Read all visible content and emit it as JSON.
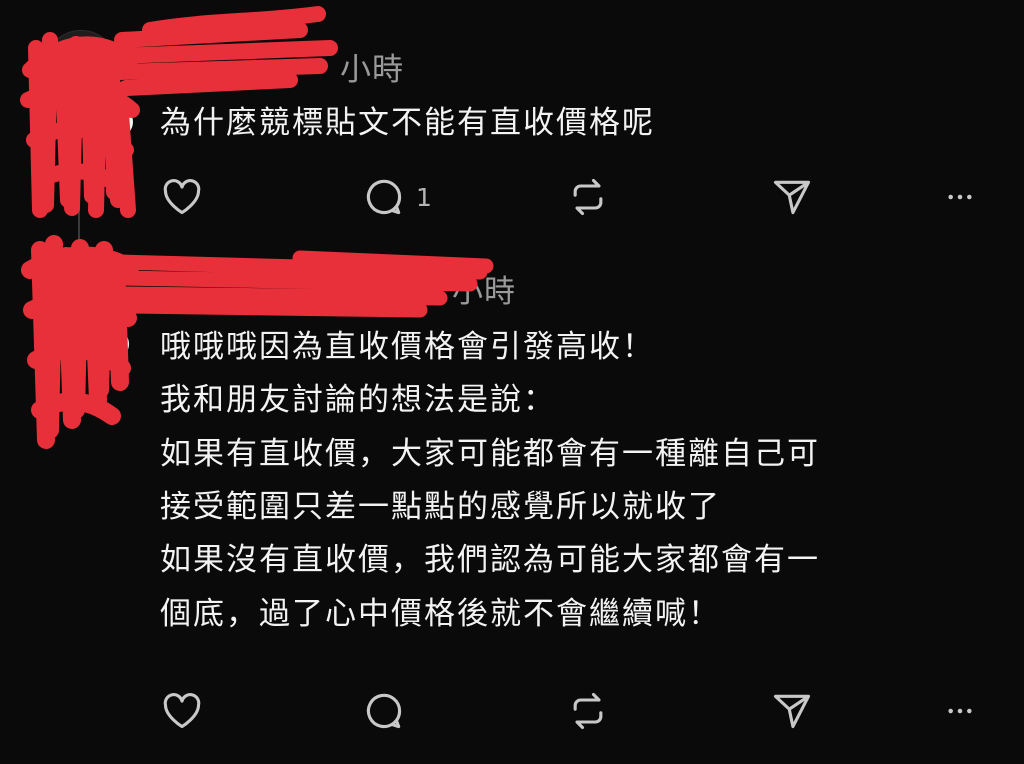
{
  "posts": [
    {
      "timestamp": "小時",
      "text": "為什麼競標貼文不能有直收價格呢",
      "actions": {
        "reply_count": "1"
      }
    },
    {
      "timestamp": "小時",
      "text": "哦哦哦因為直收價格會引發高收！\n我和朋友討論的想法是說：\n如果有直收價，大家可能都會有一種離自己可\n接受範圍只差一點點的感覺所以就收了\n如果沒有直收價，我們認為可能大家都會有一\n個底，過了心中價格後就不會繼續喊！",
      "actions": {
        "reply_count": ""
      }
    }
  ],
  "icons": {
    "like": "heart-icon",
    "reply": "comment-icon",
    "repost": "repost-icon",
    "share": "send-icon",
    "more": "more-icon"
  },
  "colors": {
    "background": "#0a0a0a",
    "text": "#f3f3f3",
    "secondary_text": "#9a9a9a",
    "icon": "#c8c8c8",
    "redaction": "#e8303a"
  }
}
